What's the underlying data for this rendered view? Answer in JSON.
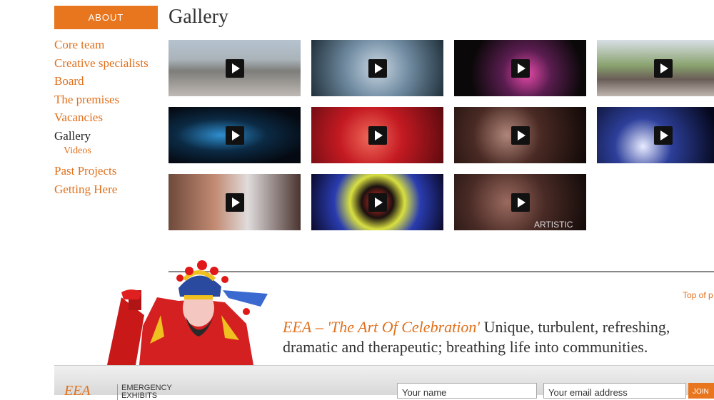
{
  "sidebar": {
    "header": "ABOUT",
    "items": [
      {
        "label": "Core team"
      },
      {
        "label": "Creative specialists"
      },
      {
        "label": "Board"
      },
      {
        "label": "The premises"
      },
      {
        "label": "Vacancies"
      },
      {
        "label": "Gallery"
      },
      {
        "label": "Videos"
      },
      {
        "label": "Past Projects"
      },
      {
        "label": "Getting Here"
      }
    ]
  },
  "main": {
    "title": "Gallery"
  },
  "videos": [
    {
      "caption": ""
    },
    {
      "caption": ""
    },
    {
      "caption": ""
    },
    {
      "caption": ""
    },
    {
      "caption": ""
    },
    {
      "caption": ""
    },
    {
      "caption": ""
    },
    {
      "caption": ""
    },
    {
      "caption": ""
    },
    {
      "caption": ""
    },
    {
      "caption": "ARTISTIC"
    }
  ],
  "banner": {
    "top_link": "Top of p",
    "brand": "EEA",
    "dash": " – ",
    "title": "'The Art Of Celebration'",
    "text1": " Unique, turbulent, refreshing,",
    "text2": "dramatic and therapeutic; breathing life into communities."
  },
  "footer": {
    "logo": "EEA",
    "org_line1": "EMERGENCY",
    "org_line2": "EXHIBITS",
    "name_placeholder": "Your name",
    "email_placeholder": "Your email address",
    "join_label": "JOIN"
  }
}
